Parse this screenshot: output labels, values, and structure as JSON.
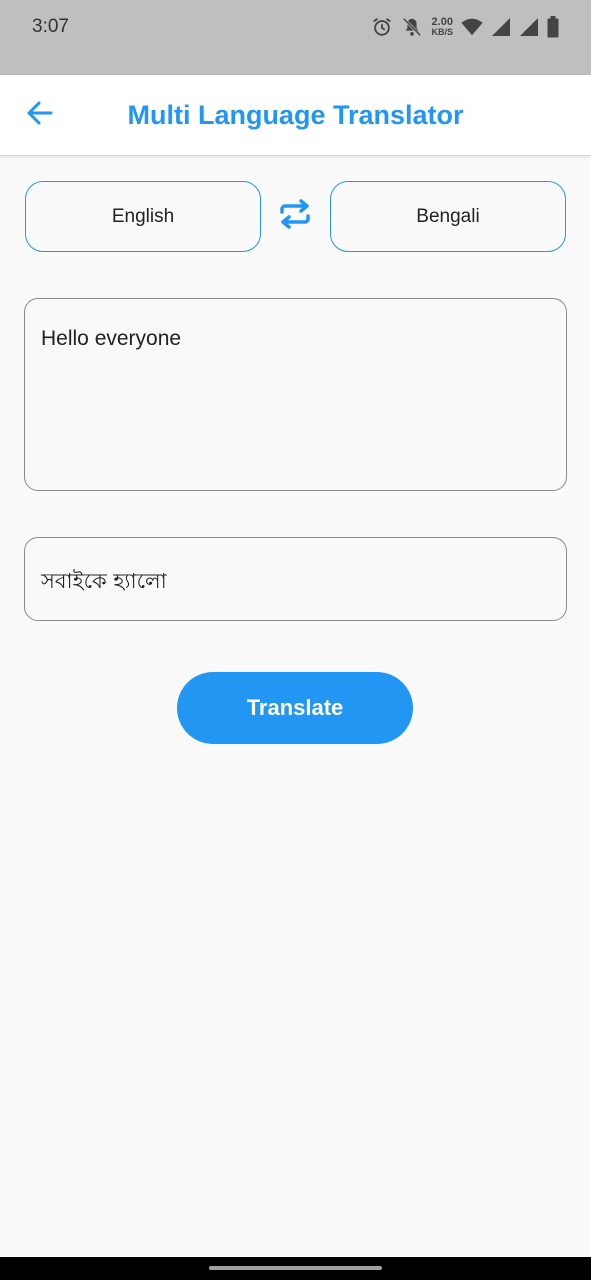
{
  "status_bar": {
    "time": "3:07",
    "net_speed_value": "2.00",
    "net_speed_unit": "KB/S",
    "icons": [
      "alarm-icon",
      "notifications-off-icon",
      "wifi-icon",
      "signal-icon",
      "signal-icon",
      "battery-icon"
    ]
  },
  "app_bar": {
    "title": "Multi Language Translator",
    "back_icon": "arrow-back-icon",
    "accent_color": "#2196f3"
  },
  "languages": {
    "source": "English",
    "target": "Bengali",
    "swap_icon": "swap-icon"
  },
  "input": {
    "text": "Hello everyone"
  },
  "output": {
    "text": "সবাইকে হ্যালো"
  },
  "actions": {
    "translate_label": "Translate"
  }
}
